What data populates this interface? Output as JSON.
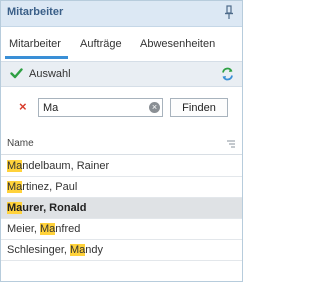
{
  "window": {
    "title": "Mitarbeiter"
  },
  "tabs": [
    {
      "label": "Mitarbeiter",
      "active": true
    },
    {
      "label": "Aufträge",
      "active": false
    },
    {
      "label": "Abwesenheiten",
      "active": false
    }
  ],
  "toolbar": {
    "label": "Auswahl"
  },
  "search": {
    "value": "Ma",
    "find_label": "Finden",
    "clear_icon": "×"
  },
  "grid": {
    "column_header": "Name",
    "rows": [
      {
        "pre": "",
        "match": "Ma",
        "post": "ndelbaum, Rainer",
        "selected": false
      },
      {
        "pre": "",
        "match": "Ma",
        "post": "rtinez, Paul",
        "selected": false
      },
      {
        "pre": "",
        "match": "Ma",
        "post": "urer, Ronald",
        "selected": true
      },
      {
        "pre": "Meier, ",
        "match": "Ma",
        "post": "nfred",
        "selected": false
      },
      {
        "pre": "Schlesinger, ",
        "match": "Ma",
        "post": "ndy",
        "selected": false
      }
    ]
  },
  "colors": {
    "accent": "#3a8fd6",
    "highlight": "#ffd23b",
    "title": "#3a5f88",
    "clear_red": "#d83b2b",
    "check_green": "#2ea043"
  }
}
